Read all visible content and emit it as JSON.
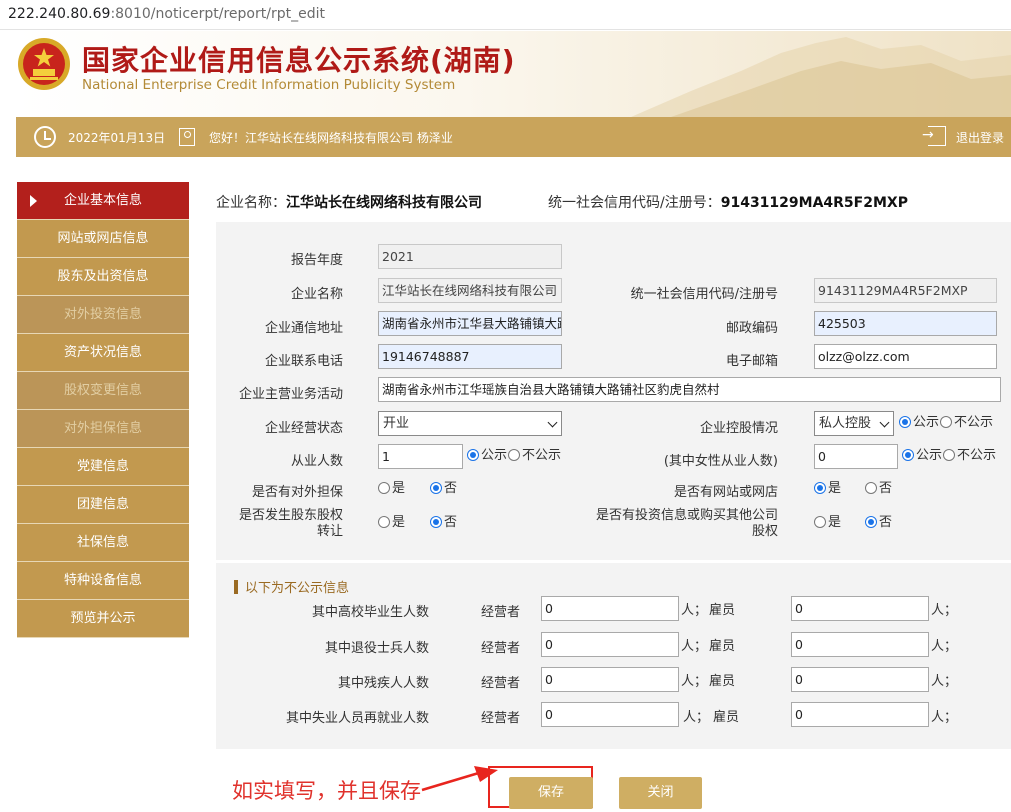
{
  "browser": {
    "url_host": "222.240.80.69",
    "url_rest": ":8010/noticerpt/report/rpt_edit"
  },
  "header": {
    "title_cn": "国家企业信用信息公示系统(湖南)",
    "title_en": "National Enterprise Credit Information Publicity System"
  },
  "topbar": {
    "date": "2022年01月13日",
    "greeting": "您好！江华站长在线网络科技有限公司  杨泽业",
    "logout": "退出登录"
  },
  "sidebar": {
    "items": [
      {
        "label": "企业基本信息",
        "state": "active"
      },
      {
        "label": "网站或网店信息",
        "state": "normal"
      },
      {
        "label": "股东及出资信息",
        "state": "normal"
      },
      {
        "label": "对外投资信息",
        "state": "disabled"
      },
      {
        "label": "资产状况信息",
        "state": "normal"
      },
      {
        "label": "股权变更信息",
        "state": "disabled"
      },
      {
        "label": "对外担保信息",
        "state": "disabled"
      },
      {
        "label": "党建信息",
        "state": "normal"
      },
      {
        "label": "团建信息",
        "state": "normal"
      },
      {
        "label": "社保信息",
        "state": "normal"
      },
      {
        "label": "特种设备信息",
        "state": "normal"
      },
      {
        "label": "预览并公示",
        "state": "normal"
      }
    ]
  },
  "company": {
    "name_label": "企业名称：",
    "name": "江华站长在线网络科技有限公司",
    "code_label": "统一社会信用代码/注册号：",
    "code": "91431129MA4R5F2MXP"
  },
  "form": {
    "report_year_label": "报告年度",
    "report_year": "2021",
    "company_name_label": "企业名称",
    "company_name": "江华站长在线网络科技有限公司",
    "credit_code_label": "统一社会信用代码/注册号",
    "credit_code": "91431129MA4R5F2MXP",
    "address_label": "企业通信地址",
    "address": "湖南省永州市江华县大路铺镇大路",
    "postcode_label": "邮政编码",
    "postcode": "425503",
    "phone_label": "企业联系电话",
    "phone": "19146748887",
    "email_label": "电子邮箱",
    "email": "olzz@olzz.com",
    "business_label": "企业主营业务活动",
    "business": "湖南省永州市江华瑶族自治县大路铺镇大路铺社区豹虎自然村",
    "status_label": "企业经营状态",
    "status": "开业",
    "control_label": "企业控股情况",
    "control": "私人控股",
    "employees_label": "从业人数",
    "employees": "1",
    "female_label": "(其中女性从业人数)",
    "female": "0",
    "public": "公示",
    "not_public": "不公示",
    "guarantee_label": "是否有对外担保",
    "website_label": "是否有网站或网店",
    "equity_transfer_label_1": "是否发生股东股权",
    "equity_transfer_label_2": "转让",
    "investment_label_1": "是否有投资信息或购买其他公司",
    "investment_label_2": "股权",
    "yes": "是",
    "no": "否"
  },
  "private": {
    "title": "以下为不公示信息",
    "operator": "经营者",
    "employee": "雇员",
    "unit_person": "人；",
    "rows": [
      {
        "label": "其中高校毕业生人数",
        "operator": "0",
        "employee": "0"
      },
      {
        "label": "其中退役士兵人数",
        "operator": "0",
        "employee": "0"
      },
      {
        "label": "其中残疾人人数",
        "operator": "0",
        "employee": "0"
      },
      {
        "label": "其中失业人员再就业人数",
        "operator": "0",
        "employee": "0"
      }
    ]
  },
  "actions": {
    "save": "保存",
    "close": "关闭"
  },
  "annotation": "如实填写，并且保存",
  "colors": {
    "gold": "#c2994f",
    "active_red": "#b3201c",
    "title_red": "#b01a17",
    "highlight_red": "#e8251e"
  }
}
